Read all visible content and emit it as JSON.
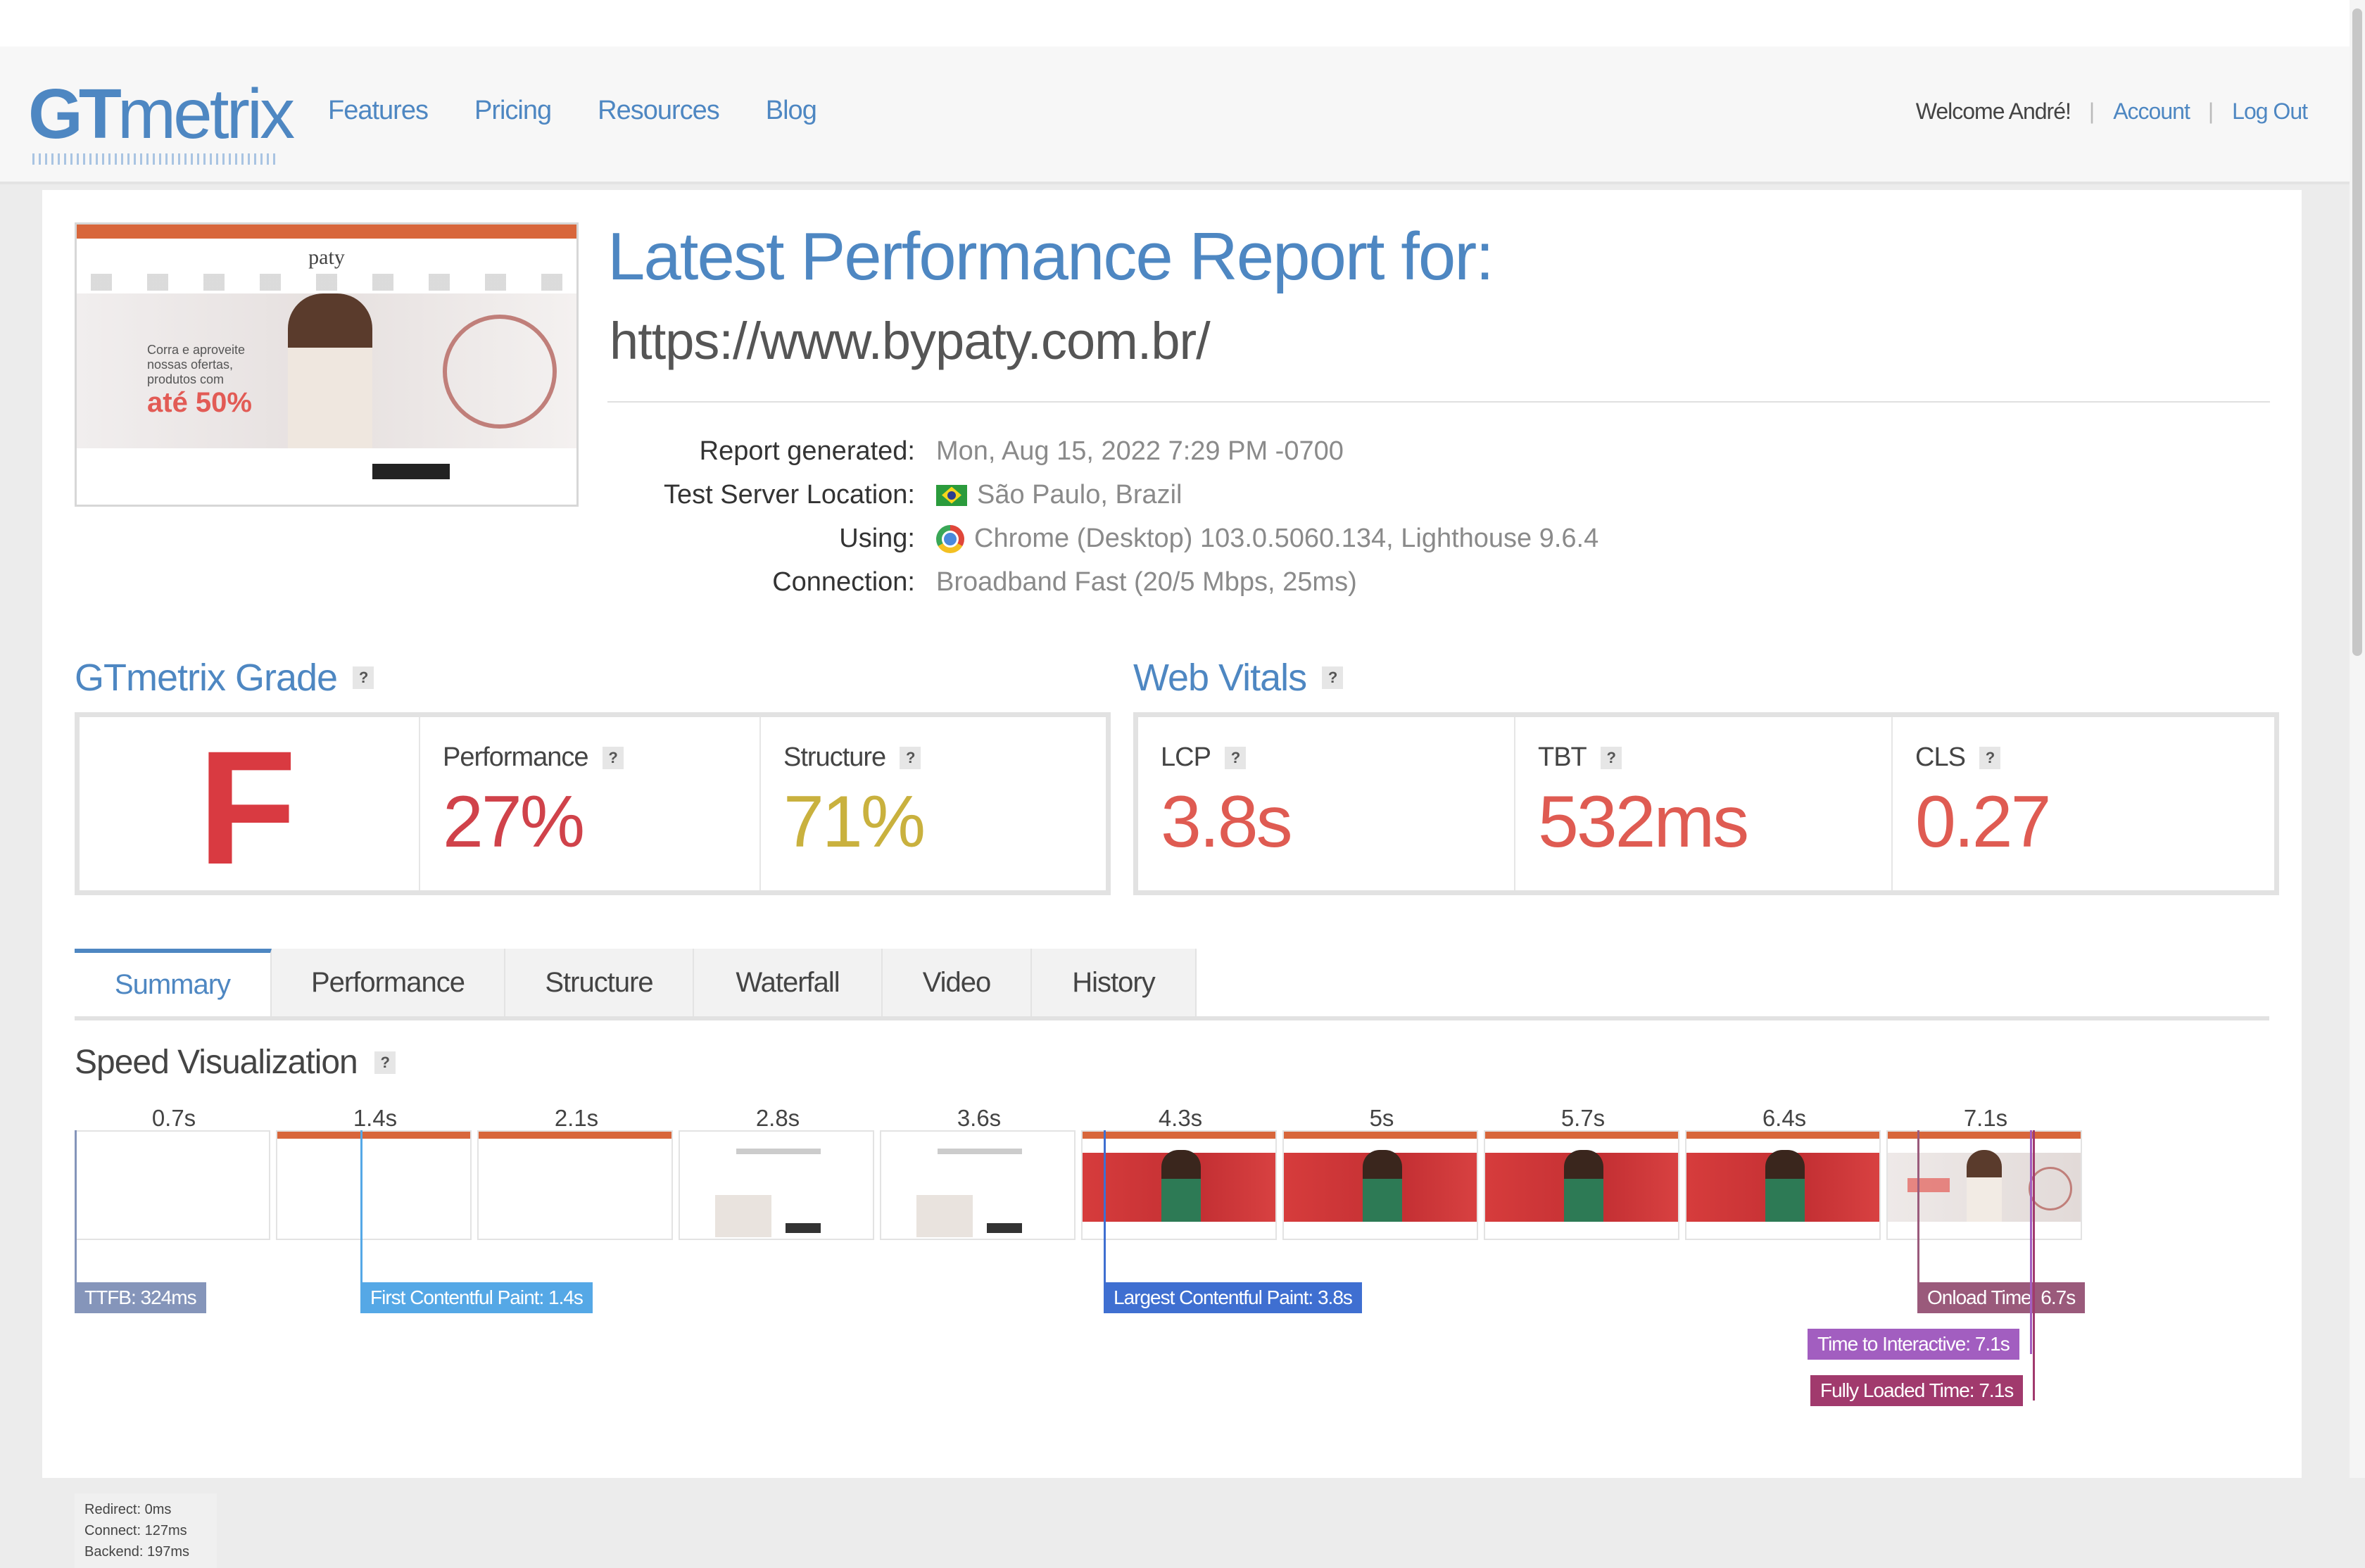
{
  "header": {
    "logo": {
      "bold": "GT",
      "rest": "metrix"
    },
    "nav": [
      "Features",
      "Pricing",
      "Resources",
      "Blog"
    ],
    "welcome": "Welcome André!",
    "account": "Account",
    "logout": "Log Out"
  },
  "report": {
    "title": "Latest Performance Report for:",
    "url": "https://www.bypaty.com.br/",
    "thumbnail_brand": "paty",
    "thumbnail_promo_line": "Corra e aproveite nossas ofertas, produtos com",
    "thumbnail_promo_big": "até 50%",
    "meta": [
      {
        "label": "Report generated:",
        "value": "Mon, Aug 15, 2022 7:29 PM -0700",
        "icon": ""
      },
      {
        "label": "Test Server Location:",
        "value": "São Paulo, Brazil",
        "icon": "brazil-flag-icon"
      },
      {
        "label": "Using:",
        "value": "Chrome (Desktop) 103.0.5060.134, Lighthouse 9.6.4",
        "icon": "chrome-icon"
      },
      {
        "label": "Connection:",
        "value": "Broadband Fast (20/5 Mbps, 25ms)",
        "icon": ""
      }
    ]
  },
  "grade": {
    "title": "GTmetrix Grade",
    "help": "?",
    "letter": "F",
    "performance": {
      "label": "Performance",
      "value": "27%",
      "color": "#d0424a"
    },
    "structure": {
      "label": "Structure",
      "value": "71%",
      "color": "#c9b13e"
    }
  },
  "vitals": {
    "title": "Web Vitals",
    "help": "?",
    "lcp": {
      "label": "LCP",
      "value": "3.8s",
      "color": "#df5b52"
    },
    "tbt": {
      "label": "TBT",
      "value": "532ms",
      "color": "#df5b52"
    },
    "cls": {
      "label": "CLS",
      "value": "0.27",
      "color": "#df5b52"
    }
  },
  "tabs": [
    "Summary",
    "Performance",
    "Structure",
    "Waterfall",
    "Video",
    "History"
  ],
  "speed": {
    "title": "Speed Visualization",
    "help": "?",
    "frame_times": [
      "0.7s",
      "1.4s",
      "2.1s",
      "2.8s",
      "3.6s",
      "4.3s",
      "5s",
      "5.7s",
      "6.4s",
      "7.1s"
    ],
    "ttfb": "TTFB: 324ms",
    "ttfb_details": [
      "Redirect: 0ms",
      "Connect: 127ms",
      "Backend: 197ms"
    ],
    "fcp": "First Contentful Paint: 1.4s",
    "lcp": "Largest Contentful Paint: 3.8s",
    "onload": "Onload Time: 6.7s",
    "tti": "Time to Interactive: 7.1s",
    "fully": "Fully Loaded Time: 7.1s",
    "colors": {
      "ttfb": "#8595ba",
      "fcp": "#55a8e6",
      "lcp": "#3f6fd1",
      "onload": "#9a5a7b",
      "tti": "#a25ec0",
      "fully": "#a13a6d"
    }
  }
}
